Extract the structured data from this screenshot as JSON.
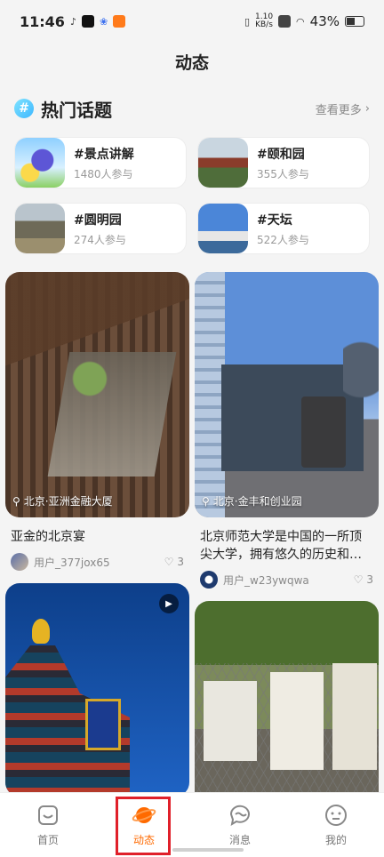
{
  "status_bar": {
    "time": "11:46",
    "net_speed_value": "1.10",
    "net_speed_unit": "KB/s",
    "battery": "43%"
  },
  "header": {
    "title": "动态"
  },
  "hot_topics": {
    "title": "热门话题",
    "more": "查看更多",
    "items": [
      {
        "name": "#景点讲解",
        "count": "1480人参与"
      },
      {
        "name": "#颐和园",
        "count": "355人参与"
      },
      {
        "name": "#圆明园",
        "count": "274人参与"
      },
      {
        "name": "#天坛",
        "count": "522人参与"
      }
    ]
  },
  "feed": {
    "posts": [
      {
        "location": "北京·亚洲金融大厦",
        "title": "亚金的北京宴",
        "author": "用户_377jox65",
        "likes": "3"
      },
      {
        "location": "北京·金丰和创业园",
        "title": "北京师范大学是中国的一所顶尖大学，拥有悠久的历史和…",
        "author": "用户_w23ywqwa",
        "likes": "3"
      }
    ]
  },
  "tabbar": {
    "items": [
      {
        "label": "首页"
      },
      {
        "label": "动态"
      },
      {
        "label": "消息"
      },
      {
        "label": "我的"
      }
    ]
  },
  "colors": {
    "accent": "#ff6a00",
    "highlight_frame": "#e0202a"
  }
}
